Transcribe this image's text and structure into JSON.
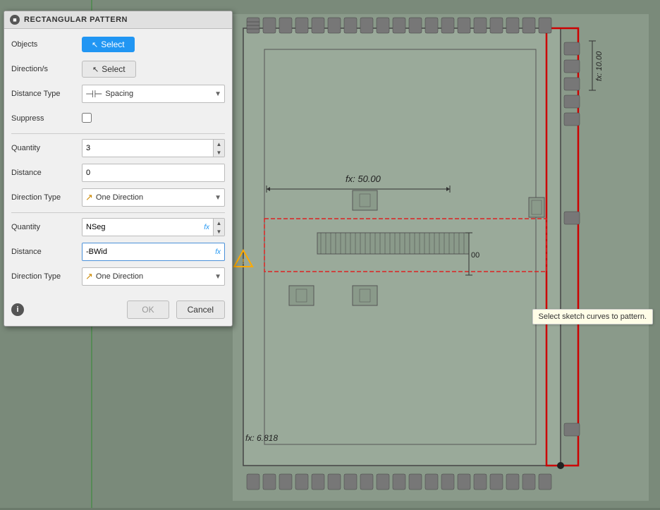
{
  "dialog": {
    "title": "RECTANGULAR PATTERN",
    "sections": {
      "objects_label": "Objects",
      "objects_btn": "Select",
      "directions_label": "Direction/s",
      "directions_btn": "Select",
      "distance_type_label": "Distance Type",
      "distance_type_value": "Spacing",
      "suppress_label": "Suppress",
      "section1": {
        "quantity_label": "Quantity",
        "quantity_value": "3",
        "distance_label": "Distance",
        "distance_value": "0",
        "direction_type_label": "Direction Type",
        "direction_type_value": "One Direction"
      },
      "section2": {
        "quantity_label": "Quantity",
        "quantity_value": "NSeg",
        "distance_label": "Distance",
        "distance_value": "-BWid",
        "direction_type_label": "Direction Type",
        "direction_type_value": "One Direction"
      }
    },
    "footer": {
      "ok_label": "OK",
      "cancel_label": "Cancel"
    }
  },
  "cad": {
    "label1": "fx: 50.00",
    "label2": "fx: 10.00",
    "label3": "fx: 6.818",
    "label4": "00"
  },
  "tooltip": {
    "text": "Select sketch curves to pattern."
  },
  "icons": {
    "cursor": "↖",
    "direction": "↗",
    "info": "i",
    "title_circle": "■"
  }
}
